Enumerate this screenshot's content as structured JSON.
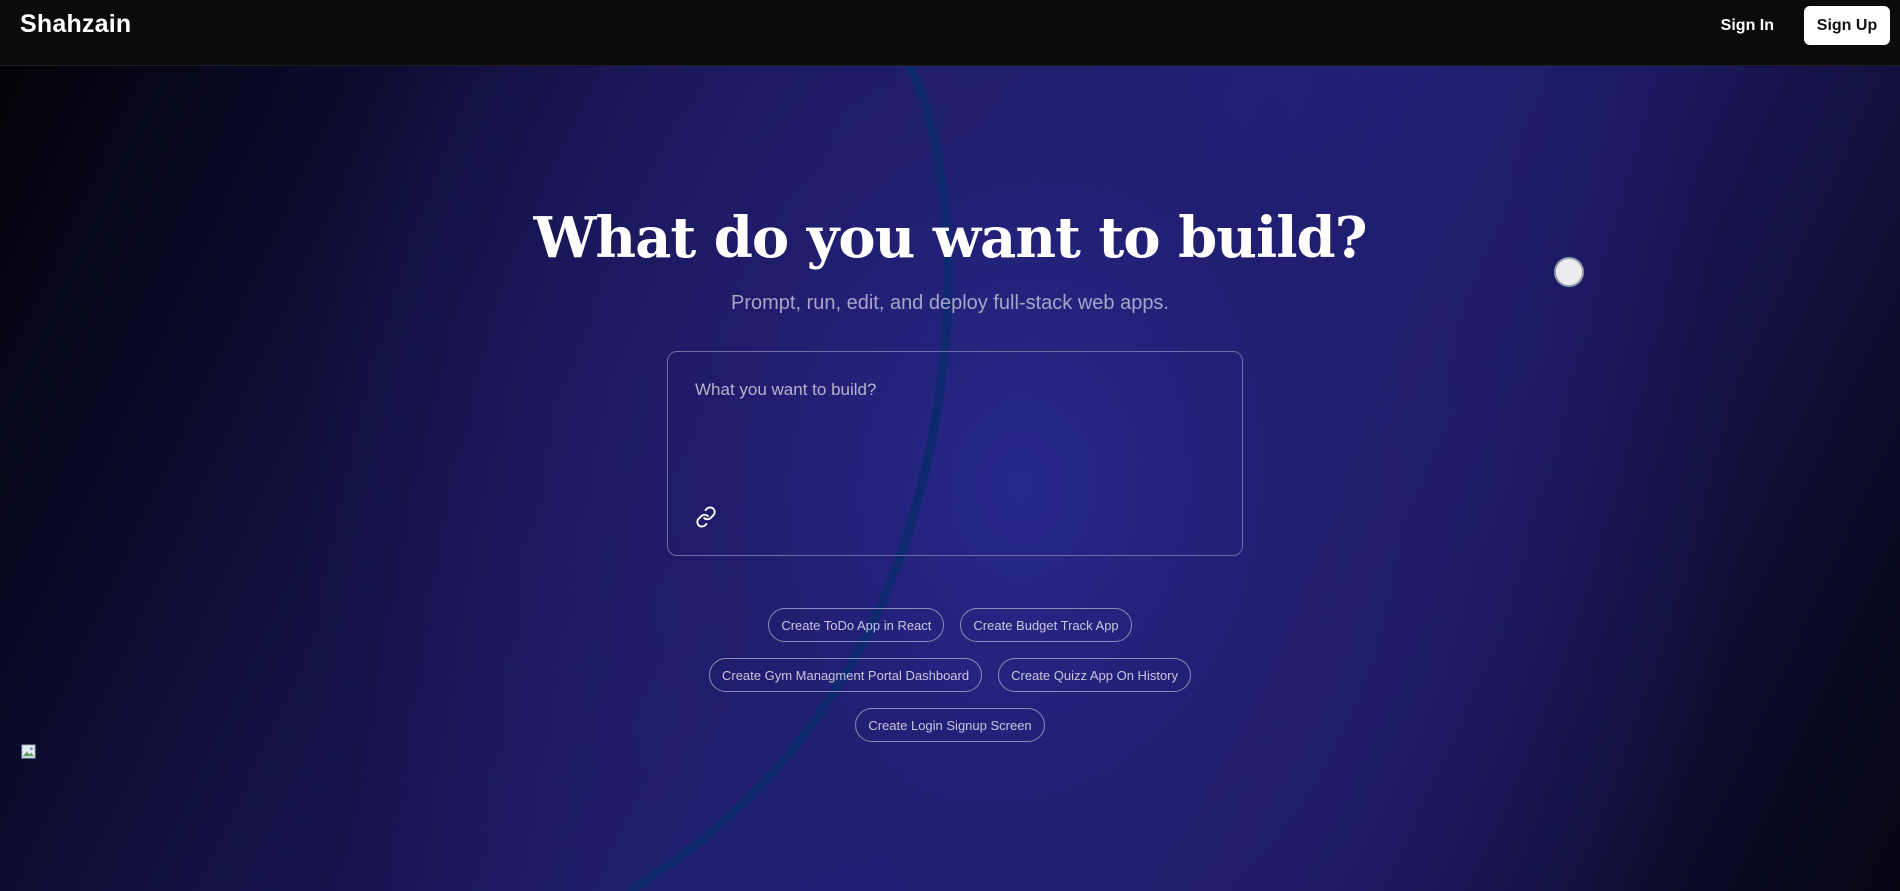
{
  "header": {
    "brand": "Shahzain",
    "signin_label": "Sign In",
    "signup_label": "Sign Up"
  },
  "hero": {
    "title": "What do you want to build?",
    "subtitle": "Prompt, run, edit, and deploy full-stack web apps."
  },
  "prompt": {
    "placeholder": "What you want to build?",
    "value": ""
  },
  "suggestions": {
    "row1": [
      "Create ToDo App in React",
      "Create Budget Track App"
    ],
    "row2": [
      "Create Gym Managment Portal Dashboard",
      "Create Quizz App On History"
    ],
    "row3": [
      "Create Login Signup Screen"
    ]
  },
  "icons": {
    "attach": "link-icon",
    "broken_image": "broken-image-icon"
  },
  "colors": {
    "header_bg": "#0b0b0b",
    "hero_accent": "#232383",
    "arc": "#0a2a6a"
  }
}
